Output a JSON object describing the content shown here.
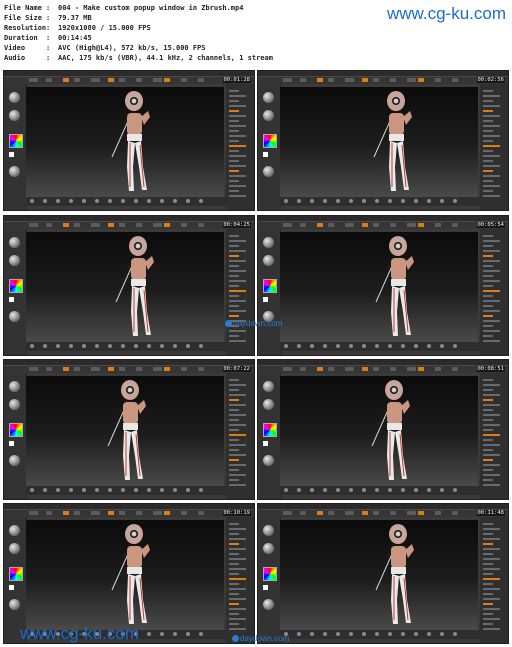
{
  "file_info": [
    {
      "key": "File Name",
      "value": "004 - Make custom popup window in Zbrush.mp4"
    },
    {
      "key": "File Size",
      "value": "79.37 MB"
    },
    {
      "key": "Resolution",
      "value": "1920x1080 / 15.000 FPS"
    },
    {
      "key": "Duration",
      "value": "00:14:45"
    },
    {
      "key": "Video",
      "value": "AVC (High@L4), 572 kb/s, 15.000 FPS"
    },
    {
      "key": "Audio",
      "value": "AAC, 175 kb/s (VBR), 44.1 kHz, 2 channels, 1 stream"
    }
  ],
  "separator": ":",
  "watermarks": {
    "top": "www.cg-ku.com",
    "bottom": "www.cg-ku.com"
  },
  "thumbnails": [
    {
      "timestamp": "00:01:28"
    },
    {
      "timestamp": "00:02:56"
    },
    {
      "timestamp": "00:04:25"
    },
    {
      "timestamp": "00:05:54"
    },
    {
      "timestamp": "00:07:22"
    },
    {
      "timestamp": "00:08:51"
    },
    {
      "timestamp": "00:10:19"
    },
    {
      "timestamp": "00:11:48"
    }
  ],
  "overlay_marks": {
    "daydown_1": "daydown.com",
    "daydown_2": "daydown.com"
  },
  "colors": {
    "accent_orange": "#e07b1a",
    "watermark_blue": "#1a6cd1",
    "ui_dark": "#3a3a3a"
  }
}
